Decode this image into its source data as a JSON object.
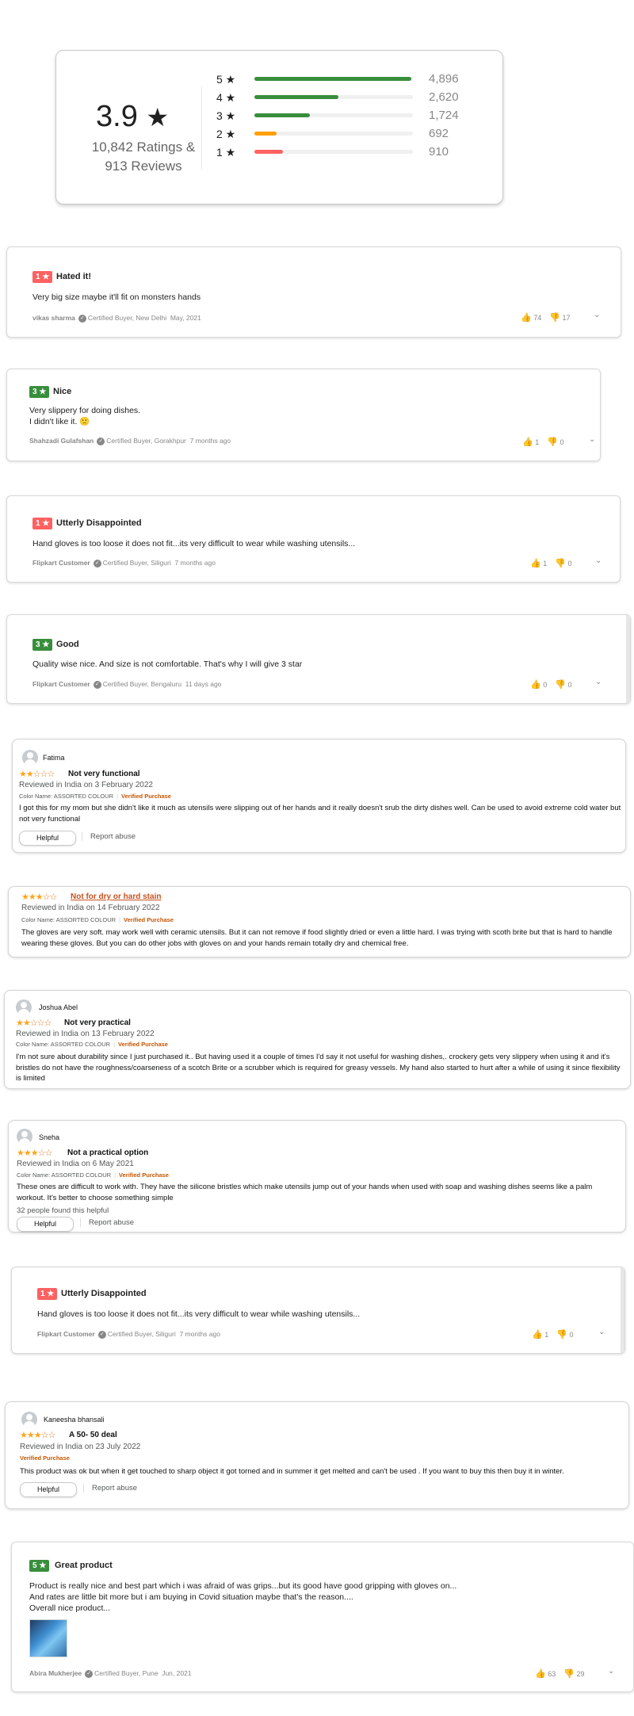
{
  "summary": {
    "average": "3.9",
    "star": "★",
    "ratings": "10,842 Ratings &",
    "reviews": "913 Reviews",
    "bars": [
      {
        "label": "5 ★",
        "count": "4,896",
        "fraction": 0.99,
        "color": "#388e3c"
      },
      {
        "label": "4 ★",
        "count": "2,620",
        "fraction": 0.53,
        "color": "#388e3c"
      },
      {
        "label": "3 ★",
        "count": "1,724",
        "fraction": 0.35,
        "color": "#388e3c"
      },
      {
        "label": "2 ★",
        "count": "692",
        "fraction": 0.14,
        "color": "#ff9f00"
      },
      {
        "label": "1 ★",
        "count": "910",
        "fraction": 0.18,
        "color": "#ff6161"
      }
    ]
  },
  "r1": {
    "badge": "1 ★",
    "title": "Hated it!",
    "body": "Very big size maybe it'll fit on monsters hands",
    "author": "vikas sharma",
    "cert": "Certified Buyer, New Delhi",
    "time": "May, 2021",
    "up": "74",
    "down": "17"
  },
  "r2": {
    "badge": "3 ★",
    "title": "Nice",
    "line1": "Very slippery for doing dishes.",
    "line2": "I didn't like it. 🙁",
    "author": "Shahzadi Gulafshan",
    "cert": "Certified Buyer, Gorakhpur",
    "time": "7 months ago",
    "up": "1",
    "down": "0"
  },
  "r3": {
    "badge": "1 ★",
    "title": "Utterly Disappointed",
    "body": "Hand gloves is too loose it does not fit...its very difficult to wear while washing utensils...",
    "author": "Flipkart Customer",
    "cert": "Certified Buyer, Siliguri",
    "time": "7 months ago",
    "up": "1",
    "down": "0"
  },
  "r4": {
    "badge": "3 ★",
    "title": "Good",
    "body": "Quality wise nice. And size is not comfortable. That's why I will give 3 star",
    "author": "Flipkart Customer",
    "cert": "Certified Buyer, Bengaluru",
    "time": "11 days ago",
    "up": "0",
    "down": "0"
  },
  "r5": {
    "name": "Fatima",
    "stars": 2,
    "title": "Not very functional",
    "date": "Reviewed in India on 3 February 2022",
    "color": "Color Name: ASSORTED COLOUR",
    "verified": "Verified Purchase",
    "body": "I got this for my mom but she didn't like it much as utensils were slipping out of her hands and it really doesn't srub the dirty dishes well. Can be used to avoid extreme cold water but not very functional",
    "helpful": "Helpful",
    "abuse": "Report abuse"
  },
  "r6": {
    "stars": 3,
    "title": "Not for dry or hard stain",
    "date": "Reviewed in India on 14 February 2022",
    "color": "Color Name: ASSORTED COLOUR",
    "verified": "Verified Purchase",
    "body": "The gloves are very soft. may work well with ceramic utensils. But it can not remove if food slightly dried or even a little hard. I was trying with scoth brite but that is hard to handle wearing these gloves. But you can do other jobs with gloves on and your hands remain totally dry and chemical free."
  },
  "r7": {
    "name": "Joshua Abel",
    "stars": 2,
    "title": "Not very practical",
    "date": "Reviewed in India on 13 February 2022",
    "color": "Color Name: ASSORTED COLOUR",
    "verified": "Verified Purchase",
    "body": "I'm not sure about durability since I just purchased it.. But having used it a couple of times I'd say it not useful for washing dishes,. crockery gets very slippery when using it and it's bristles do not have the roughness/coarseness of a scotch Brite or a scrubber which is required for greasy vessels. My hand also started to hurt after a while of using it since flexibility is limited"
  },
  "r8": {
    "name": "Sneha",
    "stars": 3,
    "title": "Not a practical option",
    "date": "Reviewed in India on 6 May 2021",
    "color": "Color Name: ASSORTED COLOUR",
    "verified": "Verified Purchase",
    "body": "These ones are difficult to work with. They have the silicone bristles which make utensils jump out of your hands when used with soap and washing dishes seems like a palm workout. It's better to choose something simple",
    "found": "32 people found this helpful",
    "helpful": "Helpful",
    "abuse": "Report abuse"
  },
  "r9": {
    "badge": "1 ★",
    "title": "Utterly Disappointed",
    "body": "Hand gloves is too loose it does not fit...its very difficult to wear while washing utensils...",
    "author": "Flipkart Customer",
    "cert": "Certified Buyer, Siliguri",
    "time": "7 months ago",
    "up": "1",
    "down": "0"
  },
  "r10": {
    "name": "Kaneesha bhansali",
    "stars": 3,
    "title": "A 50- 50 deal",
    "date": "Reviewed in India on 23 July 2022",
    "verified": "Verified Purchase",
    "body": "This product was ok but when it get touched to sharp object it got torned and in summer it get melted and can't be used . If you want to buy this then buy it in winter.",
    "helpful": "Helpful",
    "abuse": "Report abuse"
  },
  "r11": {
    "badge": "5 ★",
    "title": "Great product",
    "line1": "Product is really nice and best part which i was afraid of was grips...but its good have good gripping with gloves on...",
    "line2": "And rates are little bit more but i am buying in Covid situation maybe that's the reason....",
    "line3": "Overall nice product...",
    "author": "Abira Mukherjee",
    "cert": "Certified Buyer, Pune",
    "time": "Jun, 2021",
    "up": "63",
    "down": "29"
  },
  "icons": {
    "check": "✓",
    "thumb_up": "👍",
    "thumb_down": "👎",
    "chevron": "⌄",
    "star_full": "★",
    "star_empty": "☆"
  },
  "colors": {
    "fk_red": "#ff6161",
    "fk_green": "#388e3c",
    "amazon_star": "#ffa41c",
    "verified": "#c45500"
  }
}
